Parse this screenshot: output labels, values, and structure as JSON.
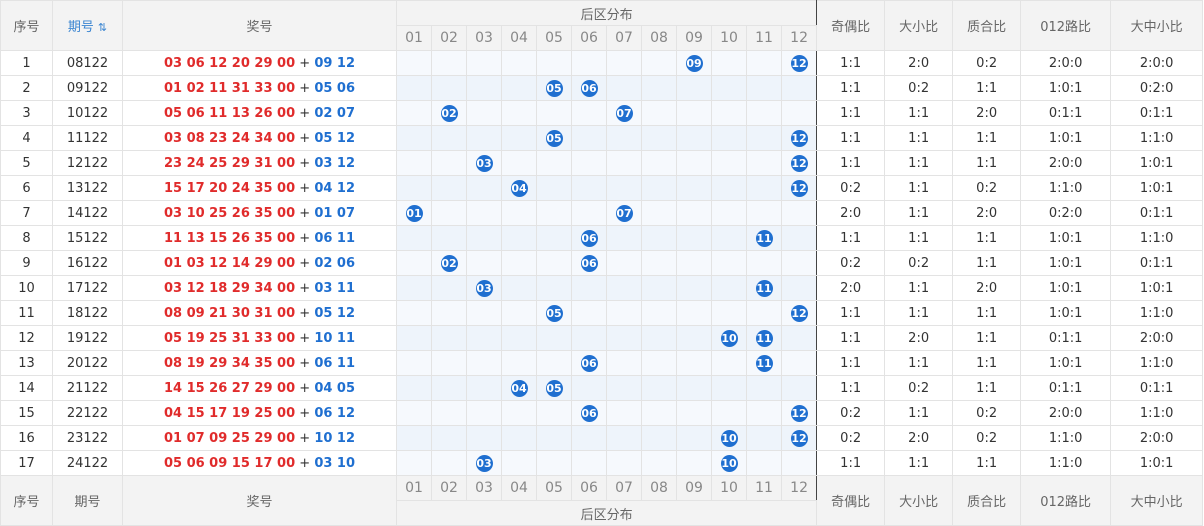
{
  "header": {
    "col_seq": "序号",
    "col_issue": "期号",
    "col_draw": "奖号",
    "col_zone": "后区分布",
    "col_odd_even": "奇偶比",
    "col_big_small": "大小比",
    "col_prime": "质合比",
    "col_012": "012路比",
    "col_bms": "大中小比",
    "zone_numbers": [
      "01",
      "02",
      "03",
      "04",
      "05",
      "06",
      "07",
      "08",
      "09",
      "10",
      "11",
      "12"
    ]
  },
  "rows": [
    {
      "seq": "1",
      "issue": "08122",
      "front": "03 06 12 20 29 00",
      "back": "09 12",
      "balls": [
        "09",
        "12"
      ],
      "oe": "1:1",
      "bs": "2:0",
      "pc": "0:2",
      "r012": "2:0:0",
      "bms": "2:0:0"
    },
    {
      "seq": "2",
      "issue": "09122",
      "front": "01 02 11 31 33 00",
      "back": "05 06",
      "balls": [
        "05",
        "06"
      ],
      "oe": "1:1",
      "bs": "0:2",
      "pc": "1:1",
      "r012": "1:0:1",
      "bms": "0:2:0"
    },
    {
      "seq": "3",
      "issue": "10122",
      "front": "05 06 11 13 26 00",
      "back": "02 07",
      "balls": [
        "02",
        "07"
      ],
      "oe": "1:1",
      "bs": "1:1",
      "pc": "2:0",
      "r012": "0:1:1",
      "bms": "0:1:1"
    },
    {
      "seq": "4",
      "issue": "11122",
      "front": "03 08 23 24 34 00",
      "back": "05 12",
      "balls": [
        "05",
        "12"
      ],
      "oe": "1:1",
      "bs": "1:1",
      "pc": "1:1",
      "r012": "1:0:1",
      "bms": "1:1:0"
    },
    {
      "seq": "5",
      "issue": "12122",
      "front": "23 24 25 29 31 00",
      "back": "03 12",
      "balls": [
        "03",
        "12"
      ],
      "oe": "1:1",
      "bs": "1:1",
      "pc": "1:1",
      "r012": "2:0:0",
      "bms": "1:0:1"
    },
    {
      "seq": "6",
      "issue": "13122",
      "front": "15 17 20 24 35 00",
      "back": "04 12",
      "balls": [
        "04",
        "12"
      ],
      "oe": "0:2",
      "bs": "1:1",
      "pc": "0:2",
      "r012": "1:1:0",
      "bms": "1:0:1"
    },
    {
      "seq": "7",
      "issue": "14122",
      "front": "03 10 25 26 35 00",
      "back": "01 07",
      "balls": [
        "01",
        "07"
      ],
      "oe": "2:0",
      "bs": "1:1",
      "pc": "2:0",
      "r012": "0:2:0",
      "bms": "0:1:1"
    },
    {
      "seq": "8",
      "issue": "15122",
      "front": "11 13 15 26 35 00",
      "back": "06 11",
      "balls": [
        "06",
        "11"
      ],
      "oe": "1:1",
      "bs": "1:1",
      "pc": "1:1",
      "r012": "1:0:1",
      "bms": "1:1:0"
    },
    {
      "seq": "9",
      "issue": "16122",
      "front": "01 03 12 14 29 00",
      "back": "02 06",
      "balls": [
        "02",
        "06"
      ],
      "oe": "0:2",
      "bs": "0:2",
      "pc": "1:1",
      "r012": "1:0:1",
      "bms": "0:1:1"
    },
    {
      "seq": "10",
      "issue": "17122",
      "front": "03 12 18 29 34 00",
      "back": "03 11",
      "balls": [
        "03",
        "11"
      ],
      "oe": "2:0",
      "bs": "1:1",
      "pc": "2:0",
      "r012": "1:0:1",
      "bms": "1:0:1"
    },
    {
      "seq": "11",
      "issue": "18122",
      "front": "08 09 21 30 31 00",
      "back": "05 12",
      "balls": [
        "05",
        "12"
      ],
      "oe": "1:1",
      "bs": "1:1",
      "pc": "1:1",
      "r012": "1:0:1",
      "bms": "1:1:0"
    },
    {
      "seq": "12",
      "issue": "19122",
      "front": "05 19 25 31 33 00",
      "back": "10 11",
      "balls": [
        "10",
        "11"
      ],
      "oe": "1:1",
      "bs": "2:0",
      "pc": "1:1",
      "r012": "0:1:1",
      "bms": "2:0:0"
    },
    {
      "seq": "13",
      "issue": "20122",
      "front": "08 19 29 34 35 00",
      "back": "06 11",
      "balls": [
        "06",
        "11"
      ],
      "oe": "1:1",
      "bs": "1:1",
      "pc": "1:1",
      "r012": "1:0:1",
      "bms": "1:1:0"
    },
    {
      "seq": "14",
      "issue": "21122",
      "front": "14 15 26 27 29 00",
      "back": "04 05",
      "balls": [
        "04",
        "05"
      ],
      "oe": "1:1",
      "bs": "0:2",
      "pc": "1:1",
      "r012": "0:1:1",
      "bms": "0:1:1"
    },
    {
      "seq": "15",
      "issue": "22122",
      "front": "04 15 17 19 25 00",
      "back": "06 12",
      "balls": [
        "06",
        "12"
      ],
      "oe": "0:2",
      "bs": "1:1",
      "pc": "0:2",
      "r012": "2:0:0",
      "bms": "1:1:0"
    },
    {
      "seq": "16",
      "issue": "23122",
      "front": "01 07 09 25 29 00",
      "back": "10 12",
      "balls": [
        "10",
        "12"
      ],
      "oe": "0:2",
      "bs": "2:0",
      "pc": "0:2",
      "r012": "1:1:0",
      "bms": "2:0:0"
    },
    {
      "seq": "17",
      "issue": "24122",
      "front": "05 06 09 15 17 00",
      "back": "03 10",
      "balls": [
        "03",
        "10"
      ],
      "oe": "1:1",
      "bs": "1:1",
      "pc": "1:1",
      "r012": "1:1:0",
      "bms": "1:0:1"
    }
  ],
  "colors": {
    "red": "#e02b2b",
    "blue": "#1f6fd0",
    "ball": "#1f6fd0",
    "accent": "#3a85d1"
  }
}
